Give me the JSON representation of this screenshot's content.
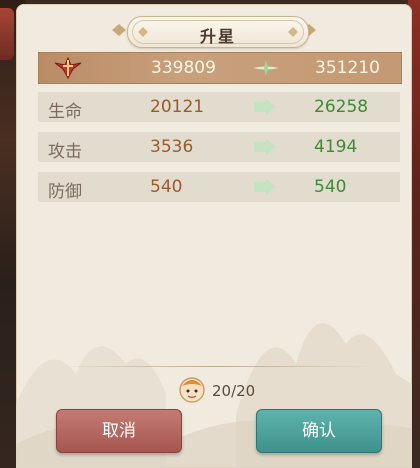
{
  "dialog": {
    "title": "升星"
  },
  "stats": [
    {
      "key": "power",
      "label": "",
      "icon": "power-sword-icon",
      "old": "339809",
      "new": "351210"
    },
    {
      "key": "hp",
      "label": "生命",
      "old": "20121",
      "new": "26258"
    },
    {
      "key": "atk",
      "label": "攻击",
      "old": "3536",
      "new": "4194"
    },
    {
      "key": "def",
      "label": "防御",
      "old": "540",
      "new": "540"
    }
  ],
  "cost": {
    "icon": "hero-avatar-icon",
    "count": "20/20"
  },
  "buttons": {
    "cancel": "取消",
    "confirm": "确认"
  },
  "colors": {
    "panel": "#f1ebdf",
    "new_value": "#3f8a35",
    "old_value": "#9a5a2e",
    "cancel": "#b3605a",
    "confirm": "#4aa39d"
  }
}
